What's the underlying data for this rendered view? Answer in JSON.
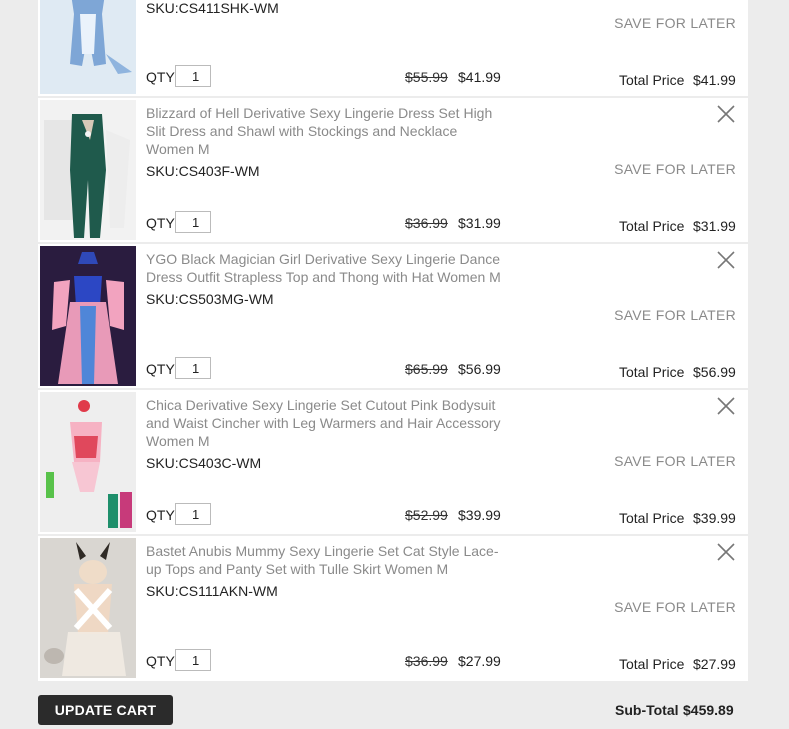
{
  "cart": {
    "qty_label": "QTY:",
    "total_label": "Total Price",
    "save_label": "SAVE FOR LATER",
    "items": [
      {
        "title": "",
        "sku": "SKU:CS411SHK-WM",
        "qty": "1",
        "old_price": "$55.99",
        "new_price": "$41.99",
        "total": "$41.99"
      },
      {
        "title": "Blizzard of Hell Derivative Sexy Lingerie Dress Set High Slit Dress and Shawl with Stockings and Necklace Women M",
        "sku": "SKU:CS403F-WM",
        "qty": "1",
        "old_price": "$36.99",
        "new_price": "$31.99",
        "total": "$31.99"
      },
      {
        "title": "YGO Black Magician Girl Derivative Sexy Lingerie Dance Dress Outfit Strapless Top and Thong with Hat Women M",
        "sku": "SKU:CS503MG-WM",
        "qty": "1",
        "old_price": "$65.99",
        "new_price": "$56.99",
        "total": "$56.99"
      },
      {
        "title": "Chica Derivative Sexy Lingerie Set Cutout Pink Bodysuit and Waist Cincher with Leg Warmers and Hair Accessory Women M",
        "sku": "SKU:CS403C-WM",
        "qty": "1",
        "old_price": "$52.99",
        "new_price": "$39.99",
        "total": "$39.99"
      },
      {
        "title": "Bastet Anubis Mummy Sexy Lingerie Set Cat Style Lace-up Tops and Panty Set with Tulle Skirt Women M",
        "sku": "SKU:CS111AKN-WM",
        "qty": "1",
        "old_price": "$36.99",
        "new_price": "$27.99",
        "total": "$27.99"
      }
    ]
  },
  "footer": {
    "update_label": "UPDATE CART",
    "subtotal_label": "Sub-Total",
    "subtotal_value": "$459.89"
  },
  "colors": {
    "background": "#ececec",
    "button": "#2b2b2b",
    "muted_text": "#8a8a8a"
  }
}
